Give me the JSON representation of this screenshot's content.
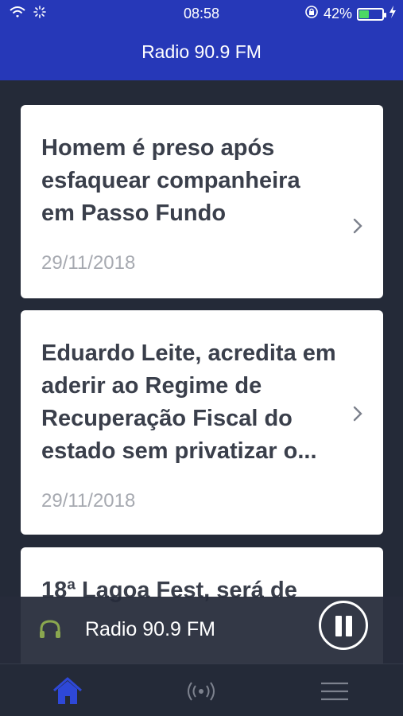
{
  "status": {
    "time": "08:58",
    "battery_percent": "42%",
    "battery_level": 0.42,
    "icons": [
      "wifi-icon",
      "loading-icon",
      "orientation-lock-icon",
      "battery-icon",
      "charging-icon"
    ]
  },
  "header": {
    "title": "Radio 90.9 FM"
  },
  "news": [
    {
      "title": "Homem é preso após esfaquear companheira em Passo Fundo",
      "date": "29/11/2018"
    },
    {
      "title": "Eduardo Leite, acredita em aderir ao Regime de Recuperação Fiscal do estado sem privatizar o...",
      "date": "29/11/2018"
    },
    {
      "title": "18ª Lagoa Fest, será de",
      "date": ""
    }
  ],
  "player": {
    "station": "Radio 90.9 FM",
    "state": "playing",
    "icon": "headphones-icon",
    "control_icon": "pause-icon"
  },
  "tabs": [
    {
      "name": "home",
      "icon": "home-icon",
      "active": true
    },
    {
      "name": "radio",
      "icon": "broadcast-icon",
      "active": false
    },
    {
      "name": "menu",
      "icon": "hamburger-menu-icon",
      "active": false
    }
  ],
  "colors": {
    "header_bg": "#2638b8",
    "app_bg": "#242a38",
    "card_bg": "#ffffff",
    "title_text": "#3a3f4b",
    "date_text": "#a6a9b0",
    "tab_active": "#2e48d8",
    "battery_fill": "#4cd964",
    "headphones": "#8aa74f"
  }
}
